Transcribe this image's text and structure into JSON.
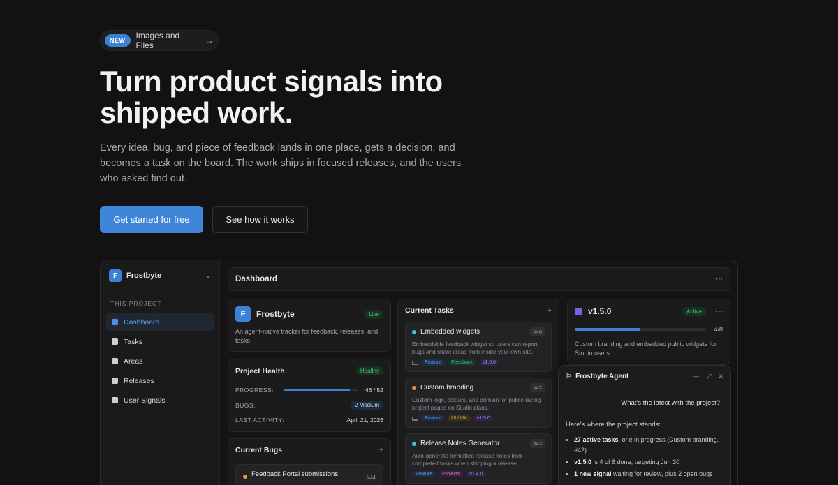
{
  "announcement": {
    "badge": "NEW",
    "text": "Images and Files",
    "arrow": "→"
  },
  "hero": {
    "title": "Turn product signals into shipped work.",
    "lead": "Every idea, bug, and piece of feedback lands in one place, gets a decision, and becomes a task on the board. The work ships in focused releases, and the users who asked find out.",
    "primary_cta": "Get started for free",
    "secondary_cta": "See how it works"
  },
  "app": {
    "project_name": "Frostbyte",
    "project_initial": "F",
    "section_label": "THIS PROJECT",
    "nav": [
      "Dashboard",
      "Tasks",
      "Areas",
      "Releases",
      "User Signals"
    ],
    "active_nav": "Dashboard",
    "page_title": "Dashboard",
    "project_card": {
      "name": "Frostbyte",
      "status": "Live",
      "description": "An agent-native tracker for feedback, releases, and tasks"
    },
    "health": {
      "title": "Project Health",
      "status": "Healthy",
      "progress_label": "PROGRESS:",
      "progress_value": "46 / 52",
      "progress_fraction": 0.885,
      "bugs_label": "BUGS:",
      "bugs_value": "2 Medium",
      "activity_label": "LAST ACTIVITY:",
      "activity_value": "April 21, 2026"
    },
    "bugs": {
      "title": "Current Bugs",
      "add": "+",
      "items": [
        {
          "title": "Feedback Portal submissions",
          "num": "#44"
        }
      ]
    },
    "tasks": {
      "title": "Current Tasks",
      "add": "+",
      "items": [
        {
          "title": "Embedded widgets",
          "num": "#46",
          "dot": "#3fc7e0",
          "desc": "Embeddable feedback widget so users can report bugs and share ideas from inside your own site.",
          "tags": [
            "Feature",
            "Feedback",
            "v1.5.0"
          ]
        },
        {
          "title": "Custom branding",
          "num": "#42",
          "dot": "#e8952f",
          "desc": "Custom logo, colours, and domain for public-facing project pages on Studio plans.",
          "tags": [
            "Feature",
            "UI / UX",
            "v1.5.0"
          ]
        },
        {
          "title": "Release Notes Generator",
          "num": "#43",
          "dot": "#3fc7e0",
          "desc": "Auto-generate formatted release notes from completed tasks when shipping a release.",
          "tags": [
            "Feature",
            "Projects",
            "v1.4.0"
          ]
        }
      ]
    },
    "release": {
      "version": "v1.5.0",
      "status": "Active",
      "more": "···",
      "progress_text": "4/8",
      "progress_fraction": 0.5,
      "description": "Custom branding and embedded public widgets for Studio users."
    },
    "agent": {
      "title": "Frostbyte Agent",
      "question": "What's the latest with the project?",
      "answer_intro": "Here's where the project stands:",
      "b1_bold": "27 active tasks",
      "b1_rest": ", one in progress (Custom branding, #42)",
      "b2_bold": "v1.5.0",
      "b2_rest": " is 4 of 8 done, targeting Jun 30",
      "b3_bold": "1 new signal",
      "b3_rest": " waiting for review, plus 2 open bugs"
    },
    "colors": {
      "accent": "#3b82d6",
      "healthy": "#4ec27a",
      "release": "#7a62e6"
    }
  }
}
